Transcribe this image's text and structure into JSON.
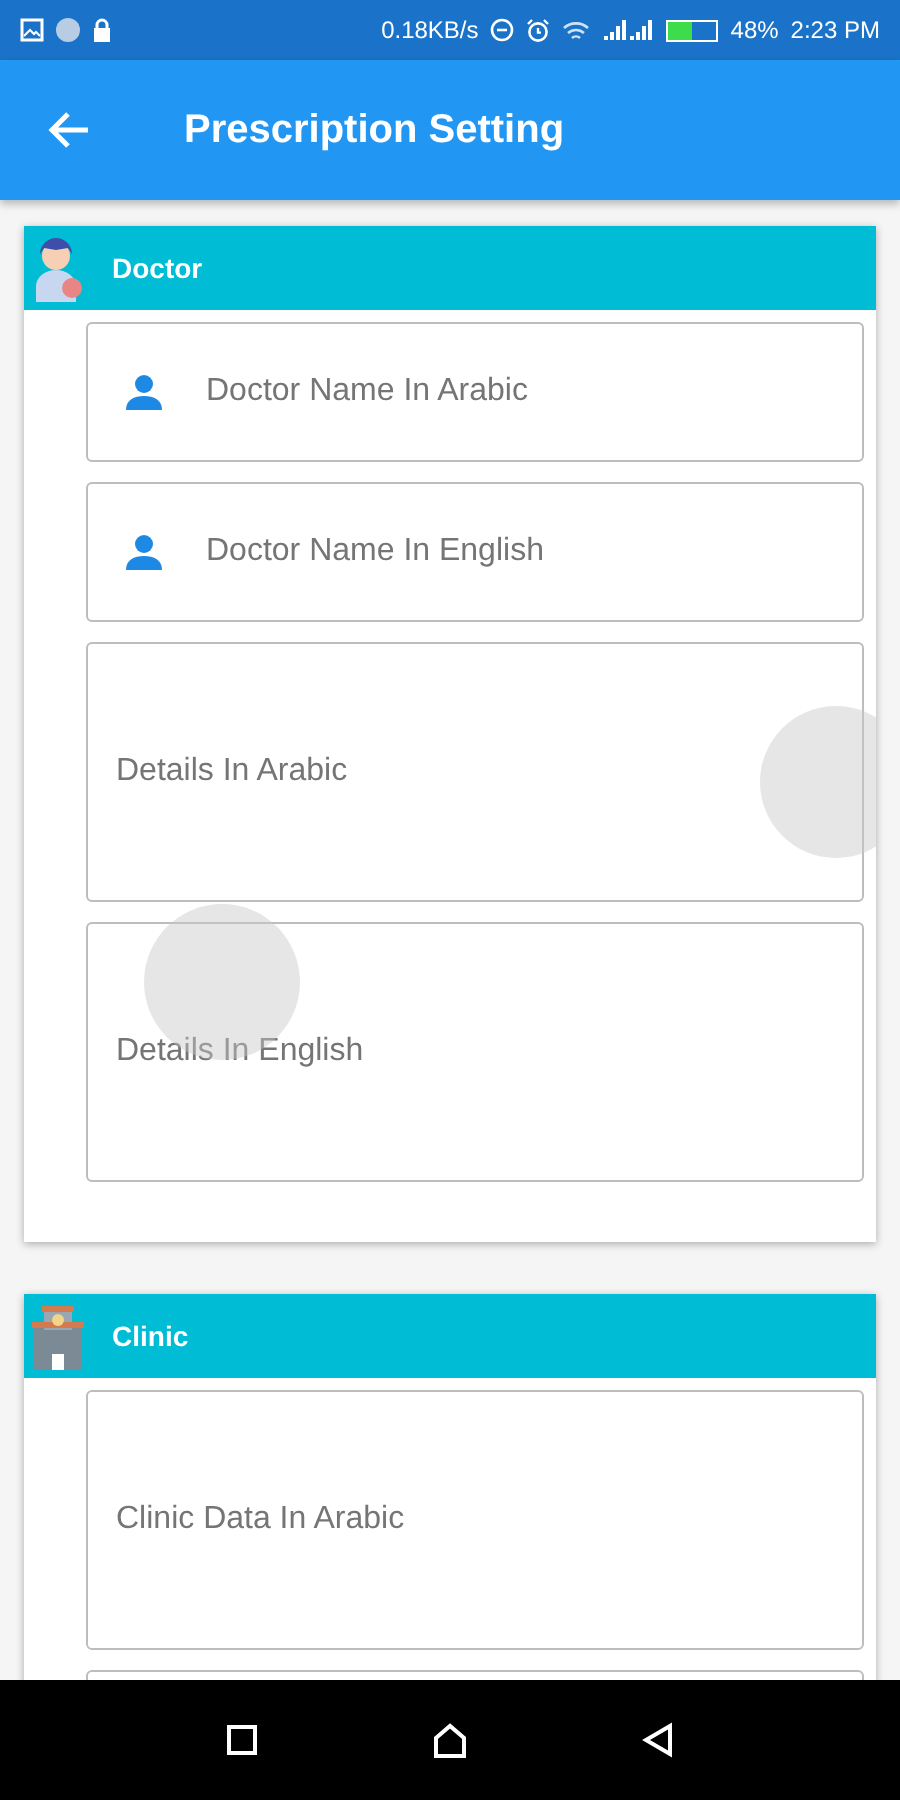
{
  "status_bar": {
    "speed": "0.18KB/s",
    "battery": "48%",
    "time": "2:23 PM"
  },
  "app_bar": {
    "title": "Prescription Setting"
  },
  "sections": [
    {
      "title": "Doctor",
      "kind": "doctor",
      "fields": [
        {
          "kind": "name",
          "placeholder": "Doctor Name In Arabic"
        },
        {
          "kind": "name",
          "placeholder": "Doctor Name In English"
        },
        {
          "kind": "details",
          "placeholder": "Details In Arabic"
        },
        {
          "kind": "details",
          "placeholder": "Details In English"
        }
      ]
    },
    {
      "title": "Clinic",
      "kind": "clinic",
      "fields": [
        {
          "kind": "details",
          "placeholder": "Clinic Data In Arabic"
        },
        {
          "kind": "details"
        }
      ]
    }
  ]
}
